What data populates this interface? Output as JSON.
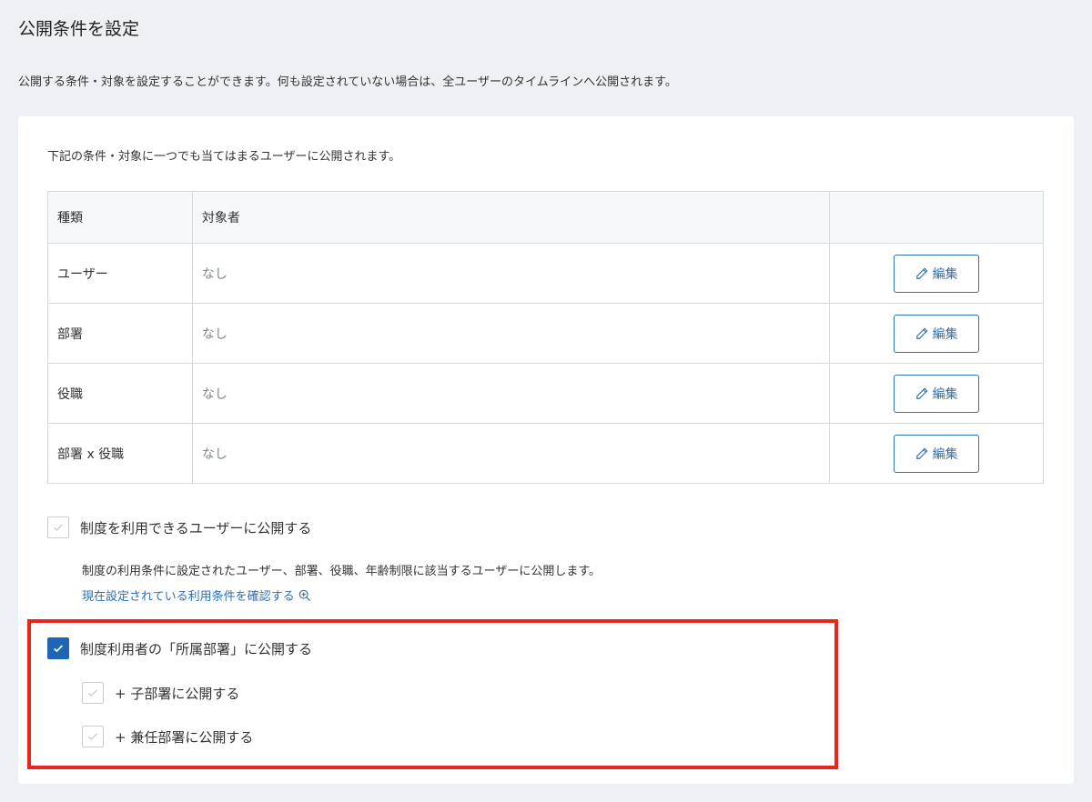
{
  "page": {
    "title": "公開条件を設定",
    "description": "公開する条件・対象を設定することができます。何も設定されていない場合は、全ユーザーのタイムラインへ公開されます。"
  },
  "card": {
    "intro": "下記の条件・対象に一つでも当てはまるユーザーに公開されます。",
    "table": {
      "headers": [
        "種類",
        "対象者",
        ""
      ],
      "rows": [
        {
          "type": "ユーザー",
          "target": "なし",
          "action": "編集"
        },
        {
          "type": "部署",
          "target": "なし",
          "action": "編集"
        },
        {
          "type": "役職",
          "target": "なし",
          "action": "編集"
        },
        {
          "type": "部署 x 役職",
          "target": "なし",
          "action": "編集"
        }
      ]
    },
    "options": {
      "eligible_users": {
        "label": "制度を利用できるユーザーに公開する",
        "checked": false,
        "description": "制度の利用条件に設定されたユーザー、部署、役職、年齢制限に該当するユーザーに公開します。",
        "link": "現在設定されている利用条件を確認する"
      },
      "department": {
        "label": "制度利用者の「所属部署」に公開する",
        "checked": true
      },
      "child_departments": {
        "label": "+ 子部署に公開する",
        "checked": false
      },
      "concurrent_departments": {
        "label": "+ 兼任部署に公開する",
        "checked": false
      }
    }
  },
  "colors": {
    "accent": "#2f6fb6",
    "checkbox_checked": "#1e66b3",
    "highlight": "#e8251e"
  }
}
